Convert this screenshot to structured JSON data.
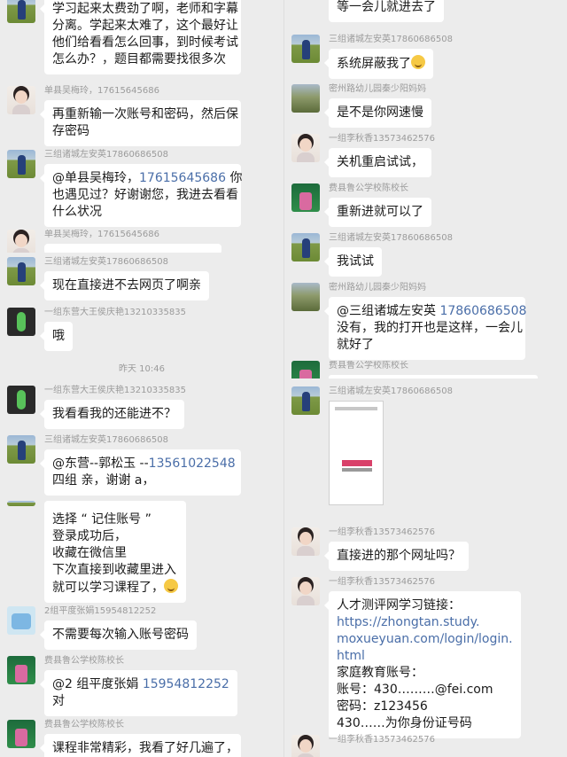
{
  "left": {
    "m0": {
      "lines": [
        "学习起来太费劲了啊，老师和字幕",
        "分离。学起来太难了，这个最好让",
        "他们给看看怎么回事，到时候考试",
        "怎么办？，题目都需要找很多次"
      ]
    },
    "m1": {
      "sender": "单县吴梅玲，17615645686",
      "lines": [
        "再重新输一次账号和密码，然后保",
        "存密码"
      ]
    },
    "m2": {
      "sender": "三组诸城左安英17860686508",
      "prefix": "@单县吴梅玲，",
      "phone": "17615645686",
      "suffix": "你",
      "lines": [
        "也遇见过？好谢谢您，我进去看看",
        "什么状况"
      ]
    },
    "m3": {
      "sender": "单县吴梅玲，17615645686"
    },
    "m4": {
      "sender": "三组诸城左安英17860686508",
      "text": "现在直接进不去网页了啊亲"
    },
    "m5": {
      "sender": "一组东营大王侯庆艳13210335835",
      "text": "哦"
    },
    "time": "昨天 10:46",
    "m6": {
      "sender": "一组东营大王侯庆艳13210335835",
      "text": "我看看我的还能进不？"
    },
    "m7": {
      "sender": "三组诸城左安英17860686508",
      "prefix": "@东营--郭松玉 --",
      "phone": "13561022548",
      "line2": "四组  亲，谢谢 a，"
    },
    "m8": {
      "lines": [
        "选择 “ 记住账号 ”",
        "登录成功后，",
        "收藏在微信里",
        "下次直接到收藏里进入",
        "就可以学习课程了，"
      ]
    },
    "m9": {
      "sender": "2组平度张娟15954812252",
      "text": "不需要每次输入账号密码"
    },
    "m10": {
      "sender": "费县鲁公学校陈校长",
      "prefix": "@2 组平度张娟 ",
      "phone": "15954812252",
      "line2": "对"
    },
    "m11": {
      "sender": "费县鲁公学校陈校长",
      "text": "课程非常精彩，我看了好几遍了，"
    }
  },
  "right": {
    "m0": {
      "text": "等一会儿就进去了"
    },
    "m1": {
      "sender": "三组诸城左安英17860686508",
      "text": "系统屏蔽我了"
    },
    "m2": {
      "sender": "密州路幼儿园秦少阳妈妈",
      "text": "是不是你网速慢"
    },
    "m3": {
      "sender": "一组李秋香13573462576",
      "text": "关机重启试试，"
    },
    "m4": {
      "sender": "费县鲁公学校陈校长",
      "text": "重新进就可以了"
    },
    "m5": {
      "sender": "三组诸城左安英17860686508",
      "text": "我试试"
    },
    "m6": {
      "sender": "密州路幼儿园秦少阳妈妈",
      "prefix": "@三组诸城左安英 ",
      "phone": "17860686508",
      "lines": [
        "没有，我的打开也是这样，一会儿",
        "就好了"
      ]
    },
    "m7": {
      "sender": "费县鲁公学校陈校长"
    },
    "m8": {
      "sender": "三组诸城左安英17860686508"
    },
    "m9": {
      "sender": "一组李秋香13573462576",
      "text": "直接进的那个网址吗？"
    },
    "m10": {
      "sender": "一组李秋香13573462576",
      "line1": "人才测评网学习链接：",
      "link": [
        "https://zhongtan.study.",
        "moxueyuan.com/login/login.",
        "html"
      ],
      "lines": [
        "家庭教育账号：",
        "账号：430………@fei.com",
        "密码：z123456",
        "430……为你身份证号码"
      ]
    },
    "m11": {
      "sender": "一组李秋香13573462576"
    }
  }
}
